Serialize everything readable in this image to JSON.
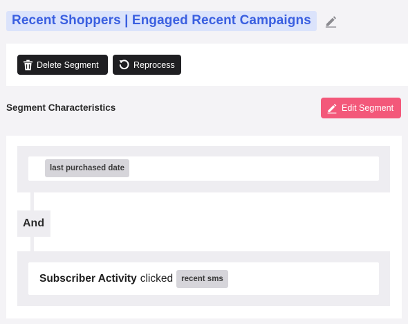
{
  "header": {
    "title": "Recent Shoppers | Engaged Recent Campaigns",
    "edit_icon": "pencil-icon"
  },
  "toolbar": {
    "delete_label": "Delete Segment",
    "delete_icon": "trash-icon",
    "reprocess_label": "Reprocess",
    "reprocess_icon": "refresh-icon"
  },
  "characteristics": {
    "heading": "Segment Characteristics",
    "edit_label": "Edit Segment",
    "edit_icon": "pencil-icon",
    "conditions": [
      {
        "chip": "last purchased date"
      },
      {
        "subject": "Subscriber Activity",
        "verb": "clicked",
        "chip": "recent sms"
      }
    ],
    "operator": "And"
  },
  "colors": {
    "title_bg": "#dbe3fb",
    "title_text": "#3a5fe0",
    "dark_button": "#1f1f22",
    "accent_pink": "#f3587a",
    "chip_bg": "#d6d5da"
  }
}
